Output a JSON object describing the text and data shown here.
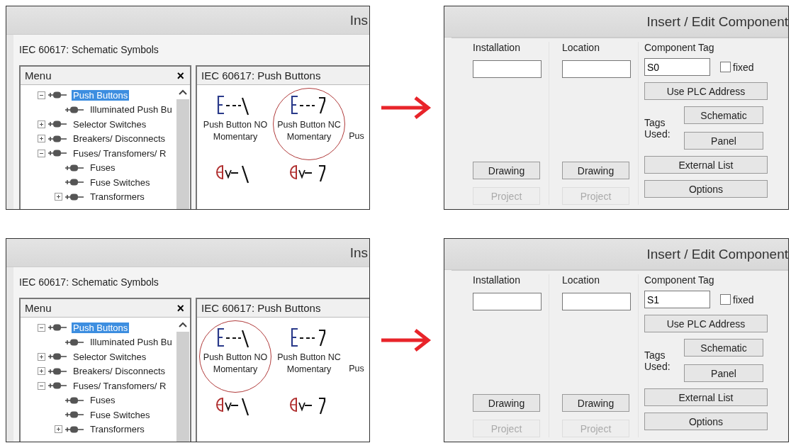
{
  "steps": [
    {
      "library": {
        "window_title": "Ins",
        "heading": "IEC 60617: Schematic Symbols",
        "menu": {
          "title": "Menu",
          "close": "×",
          "tree": [
            {
              "label": "Push Buttons",
              "expanded": true,
              "selected": true,
              "children": [
                {
                  "label": "Illuminated Push Bu",
                  "selected": false
                }
              ]
            },
            {
              "label": "Selector Switches",
              "expanded": false,
              "selected": false
            },
            {
              "label": "Breakers/ Disconnects",
              "expanded": false,
              "selected": false
            },
            {
              "label": "Fuses/ Transfomers/ R",
              "expanded": true,
              "selected": false,
              "children": [
                {
                  "label": "Fuses",
                  "selected": false
                },
                {
                  "label": "Fuse Switches",
                  "selected": false
                },
                {
                  "label": "Transformers",
                  "expanded": false,
                  "selected": false
                }
              ]
            }
          ]
        },
        "symbols_title": "IEC 60617: Push Buttons",
        "symbols": [
          {
            "kind": "pushbutton-no",
            "label": "Push Button NO Momentary",
            "circled": false
          },
          {
            "kind": "pushbutton-nc",
            "label": "Push Button NC Momentary",
            "circled": true
          },
          {
            "kind": "cut",
            "label": "Pus"
          },
          {
            "kind": "lamp-no"
          },
          {
            "kind": "lamp-nc"
          }
        ]
      },
      "dialog": {
        "title": "Insert / Edit Component",
        "columns": [
          {
            "label": "Installation",
            "drawing": "Drawing",
            "project": "Project",
            "project_disabled": true
          },
          {
            "label": "Location",
            "drawing": "Drawing",
            "project": "Project",
            "project_disabled": true
          }
        ],
        "tag_label": "Component Tag",
        "tag_value": "S0",
        "fixed_label": "fixed",
        "fixed_checked": false,
        "plc_button": "Use PLC Address",
        "tags_used_label": "Tags Used:",
        "schematic_button": "Schematic",
        "panel_button": "Panel",
        "external_button": "External List",
        "options_button": "Options"
      }
    },
    {
      "library": {
        "window_title": "Ins",
        "heading": "IEC 60617: Schematic Symbols",
        "menu": {
          "title": "Menu",
          "close": "×",
          "tree": [
            {
              "label": "Push Buttons",
              "expanded": true,
              "selected": true,
              "children": [
                {
                  "label": "Illuminated Push Bu",
                  "selected": false
                }
              ]
            },
            {
              "label": "Selector Switches",
              "expanded": false,
              "selected": false
            },
            {
              "label": "Breakers/ Disconnects",
              "expanded": false,
              "selected": false
            },
            {
              "label": "Fuses/ Transfomers/ R",
              "expanded": true,
              "selected": false,
              "children": [
                {
                  "label": "Fuses",
                  "selected": false
                },
                {
                  "label": "Fuse Switches",
                  "selected": false
                },
                {
                  "label": "Transformers",
                  "expanded": false,
                  "selected": false
                }
              ]
            }
          ]
        },
        "symbols_title": "IEC 60617: Push Buttons",
        "symbols": [
          {
            "kind": "pushbutton-no",
            "label": "Push Button NO Momentary",
            "circled": true
          },
          {
            "kind": "pushbutton-nc",
            "label": "Push Button NC Momentary",
            "circled": false
          },
          {
            "kind": "cut",
            "label": "Pus"
          },
          {
            "kind": "lamp-no"
          },
          {
            "kind": "lamp-nc"
          }
        ]
      },
      "dialog": {
        "title": "Insert / Edit Component",
        "columns": [
          {
            "label": "Installation",
            "drawing": "Drawing",
            "project": "Project",
            "project_disabled": true
          },
          {
            "label": "Location",
            "drawing": "Drawing",
            "project": "Project",
            "project_disabled": true
          }
        ],
        "tag_label": "Component Tag",
        "tag_value": "S1",
        "fixed_label": "fixed",
        "fixed_checked": false,
        "plc_button": "Use PLC Address",
        "tags_used_label": "Tags Used:",
        "schematic_button": "Schematic",
        "panel_button": "Panel",
        "external_button": "External List",
        "options_button": "Options"
      }
    }
  ]
}
